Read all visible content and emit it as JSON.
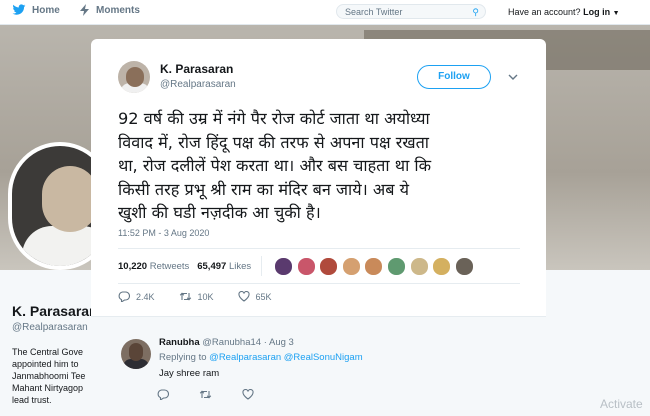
{
  "topnav": {
    "home_label": "Home",
    "moments_label": "Moments",
    "search_placeholder": "Search Twitter",
    "have_account_text": "Have an account?",
    "login_label": "Log in"
  },
  "profile": {
    "name": "K. Parasaran",
    "handle": "@Realparasaran",
    "bio": "The Central Gove\nappointed him to\nJanmabhoomi Tee\nMahant Nirtyagop\nlead trust."
  },
  "tweet": {
    "author_name": "K. Parasaran",
    "author_handle": "@Realparasaran",
    "follow_label": "Follow",
    "text": "92 वर्ष की उम्र में नंगे पैर रोज कोर्ट जाता था अयोध्या\nविवाद में, रोज हिंदू पक्ष की तरफ से अपना पक्ष रखता\nथा,  रोज दलीलें पेश करता था। और बस चाहता था कि\nकिसी तरह प्रभू श्री राम का मंदिर बन जाये। अब ये\nखुशी की घडी नज़दीक आ चुकी है।",
    "timestamp": "11:52 PM - 3 Aug 2020",
    "retweets_count": "10,220",
    "retweets_label": "Retweets",
    "likes_count": "65,497",
    "likes_label": "Likes",
    "reply_count": "2.4K",
    "retweet_action_count": "10K",
    "like_action_count": "65K",
    "liker_colors": [
      "#5a3a6e",
      "#c9566a",
      "#b04a3c",
      "#d5a070",
      "#c98a5a",
      "#5f9a70",
      "#cdb88a",
      "#d4b060",
      "#6a6258"
    ]
  },
  "reply": {
    "name": "Ranubha",
    "handle": "@Ranubha14",
    "separator": "·",
    "date": "Aug 3",
    "replying_to": "Replying to",
    "mention1": "@Realparasaran",
    "mention2": "@RealSonuNigam",
    "text": "Jay shree ram"
  },
  "watermark": "Activate",
  "colors": {
    "accent": "#1da1f2",
    "text_primary": "#14171a",
    "text_secondary": "#657786"
  }
}
